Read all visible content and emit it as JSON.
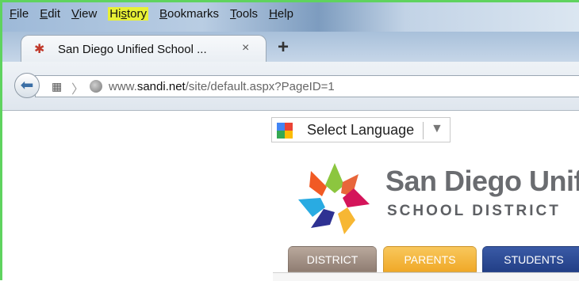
{
  "menu": {
    "items": [
      "File",
      "Edit",
      "View",
      "History",
      "Bookmarks",
      "Tools",
      "Help"
    ],
    "underline": [
      "F",
      "E",
      "V",
      "s",
      "B",
      "T",
      "H"
    ]
  },
  "tab": {
    "title": "San Diego Unified School ...",
    "close": "×",
    "new_tab": "+"
  },
  "address": {
    "url_prefix": "www.",
    "url_domain": "sandi.net",
    "url_path": "/site/default.aspx?PageID=1"
  },
  "page": {
    "language_select": "Select Language",
    "brand_name": "San Diego Unifi",
    "brand_sub": "SCHOOL DISTRICT",
    "nav_tabs": [
      "DISTRICT",
      "PARENTS",
      "STUDENTS"
    ]
  },
  "colors": {
    "highlight": "#e8f036",
    "tab_district": "#a08f84",
    "tab_parents": "#f4b73e",
    "tab_students": "#2b4a95"
  }
}
